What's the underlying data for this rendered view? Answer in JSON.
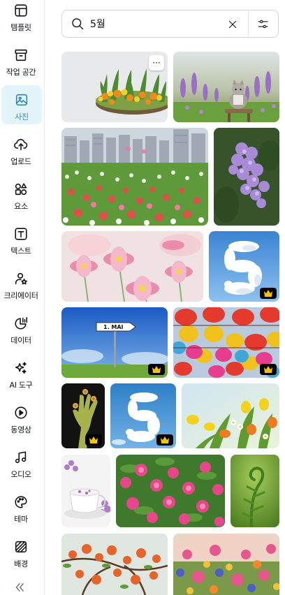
{
  "sidebar": {
    "items": [
      {
        "label": "템플릿",
        "icon": "template-icon"
      },
      {
        "label": "작업 공간",
        "icon": "workspace-icon"
      },
      {
        "label": "사진",
        "icon": "photo-icon"
      },
      {
        "label": "업로드",
        "icon": "upload-cloud-icon"
      },
      {
        "label": "요소",
        "icon": "elements-icon"
      },
      {
        "label": "텍스트",
        "icon": "text-icon"
      },
      {
        "label": "크리에이터",
        "icon": "creator-icon"
      },
      {
        "label": "데이터",
        "icon": "data-chart-icon"
      },
      {
        "label": "AI 도구",
        "icon": "ai-sparkle-icon"
      },
      {
        "label": "동영상",
        "icon": "video-play-icon"
      },
      {
        "label": "오디오",
        "icon": "music-note-icon"
      },
      {
        "label": "테마",
        "icon": "palette-icon"
      },
      {
        "label": "배경",
        "icon": "background-pattern-icon"
      }
    ],
    "active_index": 2,
    "collapse_icon": "double-chevron-left-icon"
  },
  "search": {
    "value": "5월",
    "placeholder": "",
    "search_icon": "search-icon",
    "clear_icon": "close-icon",
    "filter_icon": "filter-sliders-icon"
  },
  "results": {
    "more_label": "···",
    "premium_icon": "crown-icon",
    "images": [
      {
        "subject": "tulip flower bed",
        "premium": false,
        "has_more": true
      },
      {
        "subject": "cat with purple flowers",
        "premium": false
      },
      {
        "subject": "city flower field",
        "premium": false
      },
      {
        "subject": "lilac blossoms",
        "premium": false
      },
      {
        "subject": "pink daisies",
        "premium": false
      },
      {
        "subject": "cloud number five",
        "premium": true
      },
      {
        "subject": "street sign",
        "premium": true,
        "sign_text": "1. MAI"
      },
      {
        "subject": "paper lanterns",
        "premium": true
      },
      {
        "subject": "hand holding flowers",
        "premium": true
      },
      {
        "subject": "cloud five blue sky",
        "premium": true
      },
      {
        "subject": "spring tulips",
        "premium": false
      },
      {
        "subject": "tea cup with flowers",
        "premium": false
      },
      {
        "subject": "pink azaleas",
        "premium": false
      },
      {
        "subject": "fern frond",
        "premium": false
      },
      {
        "subject": "orange blossoms",
        "premium": false
      },
      {
        "subject": "colorful flower field",
        "premium": false
      }
    ]
  }
}
